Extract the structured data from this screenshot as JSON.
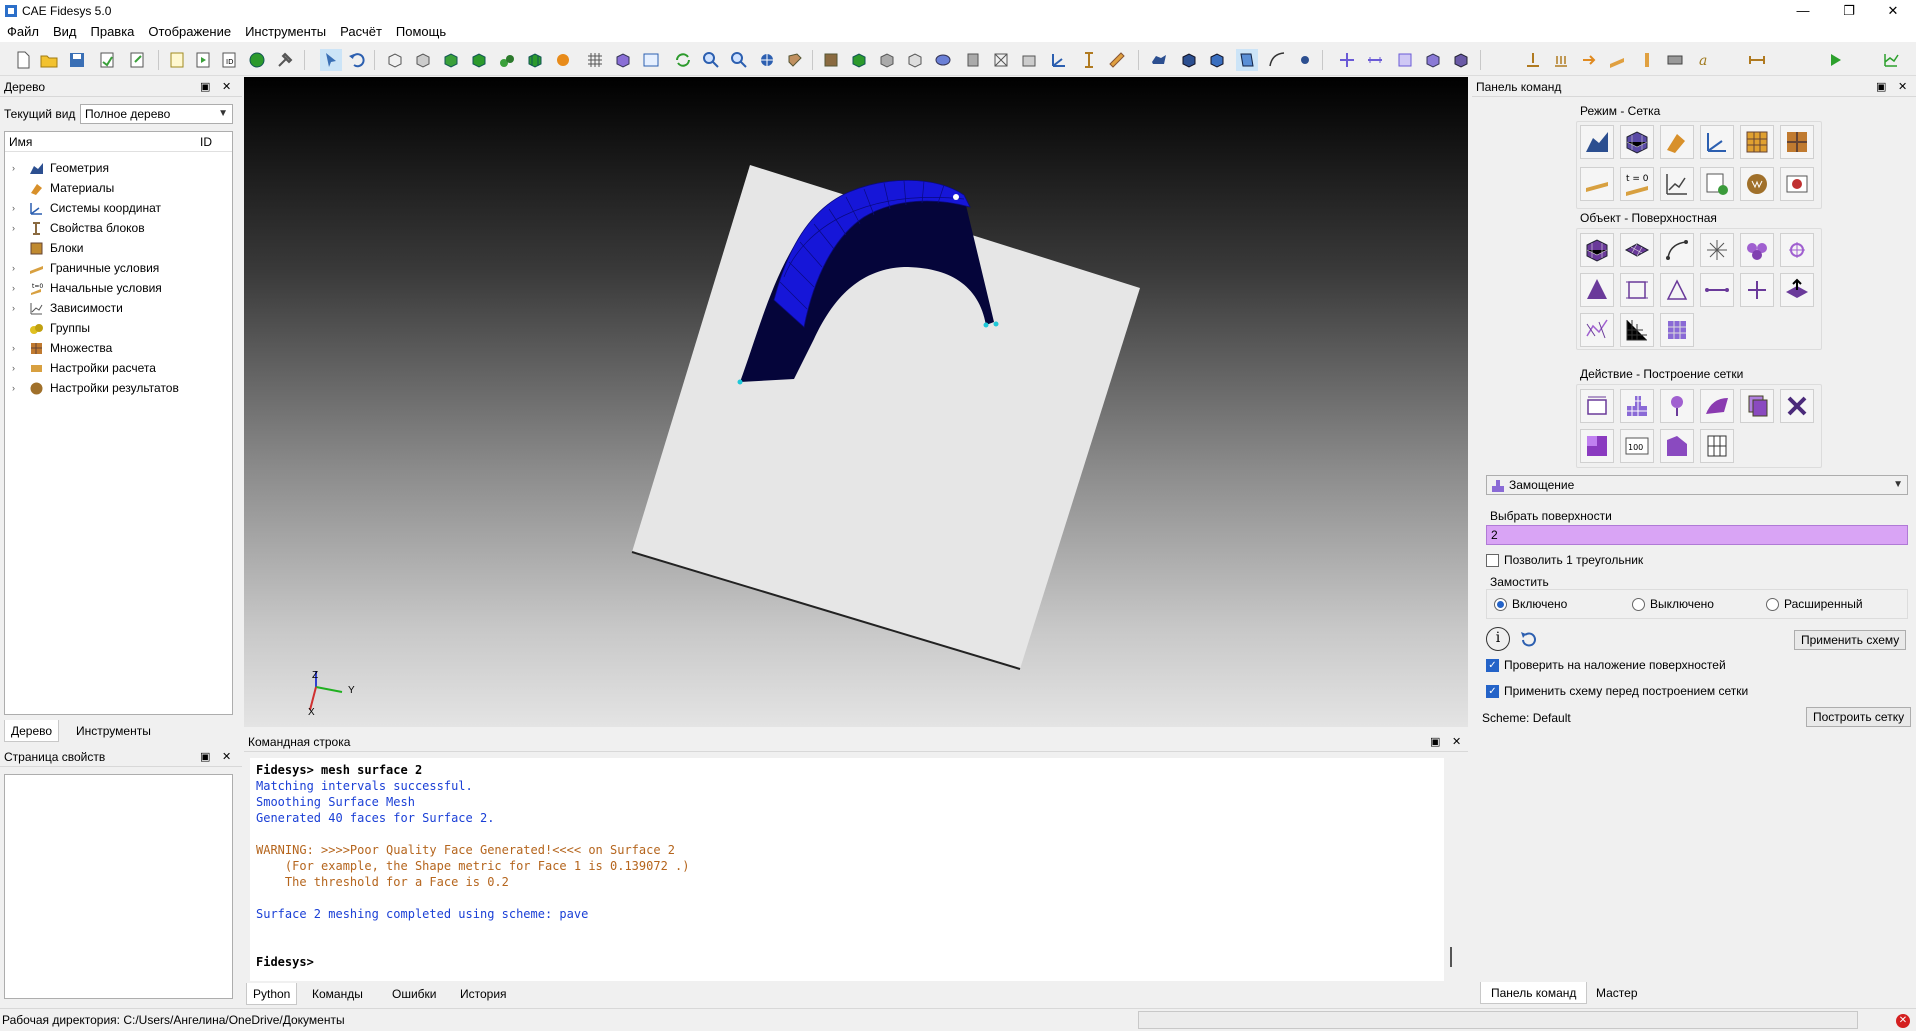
{
  "window": {
    "title": "CAE Fidesys 5.0"
  },
  "menu": [
    "Файл",
    "Вид",
    "Правка",
    "Отображение",
    "Инструменты",
    "Расчёт",
    "Помощь"
  ],
  "tree_panel": {
    "title": "Дерево",
    "current_view_label": "Текущий вид",
    "current_view_value": "Полное дерево",
    "col_name": "Имя",
    "col_id": "ID",
    "items": [
      {
        "label": "Геометрия",
        "icon": "geometry-icon"
      },
      {
        "label": "Материалы",
        "icon": "materials-icon"
      },
      {
        "label": "Системы координат",
        "icon": "coordinate-systems-icon"
      },
      {
        "label": "Свойства блоков",
        "icon": "block-properties-icon"
      },
      {
        "label": "Блоки",
        "icon": "blocks-icon"
      },
      {
        "label": "Граничные условия",
        "icon": "boundary-conditions-icon"
      },
      {
        "label": "Начальные условия",
        "icon": "initial-conditions-icon"
      },
      {
        "label": "Зависимости",
        "icon": "dependencies-icon"
      },
      {
        "label": "Группы",
        "icon": "groups-icon"
      },
      {
        "label": "Множества",
        "icon": "sets-icon"
      },
      {
        "label": "Настройки расчета",
        "icon": "analysis-settings-icon"
      },
      {
        "label": "Настройки результатов",
        "icon": "results-settings-icon"
      }
    ],
    "tabs": [
      "Дерево",
      "Инструменты"
    ]
  },
  "properties_panel": {
    "title": "Страница свойств"
  },
  "viewport": {
    "axis_z": "Z",
    "axis_y": "Y",
    "axis_x": "X"
  },
  "command_panel": {
    "title": "Командная строка",
    "lines": [
      {
        "text": "Fidesys> mesh surface 2",
        "style": "bold"
      },
      {
        "text": "Matching intervals successful.",
        "style": "blue"
      },
      {
        "text": "Smoothing Surface Mesh",
        "style": "blue"
      },
      {
        "text": "Generated 40 faces for Surface 2.",
        "style": "blue"
      },
      {
        "text": "",
        "style": "blue"
      },
      {
        "text": "WARNING: >>>>Poor Quality Face Generated!<<<< on Surface 2",
        "style": "warn"
      },
      {
        "text": "    (For example, the Shape metric for Face 1 is 0.139072 .)",
        "style": "warn"
      },
      {
        "text": "    The threshold for a Face is 0.2",
        "style": "warn"
      },
      {
        "text": "",
        "style": "blue"
      },
      {
        "text": "Surface 2 meshing completed using scheme: pave",
        "style": "blue"
      },
      {
        "text": "",
        "style": "blue"
      },
      {
        "text": "",
        "style": "blue"
      },
      {
        "text": "Fidesys>",
        "style": "bold"
      }
    ],
    "tabs": [
      "Python",
      "Команды",
      "Ошибки",
      "История"
    ]
  },
  "right_panel": {
    "title": "Панель команд",
    "group_mode": "Режим - Сетка",
    "group_object": "Объект - Поверхностная",
    "group_action": "Действие - Построение сетки",
    "scheme_combo": "Замощение",
    "select_surfaces_label": "Выбрать поверхности",
    "select_surfaces_value": "2",
    "allow_triangle": "Позволить 1 треугольник",
    "pave_label": "Замостить",
    "radio_on": "Включено",
    "radio_off": "Выключено",
    "radio_ext": "Расширенный",
    "apply_scheme": "Применить схему",
    "check_overlap": "Проверить на наложение поверхностей",
    "apply_before": "Применить схему перед построением сетки",
    "scheme_default": "Scheme: Default",
    "build_mesh": "Построить сетку",
    "tabs": [
      "Панель команд",
      "Мастер"
    ]
  },
  "statusbar": {
    "working_dir": "Рабочая директория: C:/Users/Ангелина/OneDrive/Документы"
  },
  "colors": {
    "mesh_blue": "#1a1ae6",
    "plate": "#e6e6e6",
    "highlight": "#d9a4f5",
    "accent": "#2463c8"
  }
}
